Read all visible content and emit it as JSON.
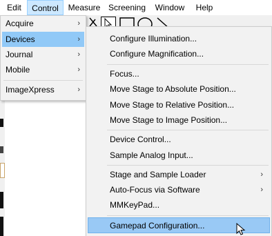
{
  "menubar": {
    "items": [
      {
        "label": "Edit"
      },
      {
        "label": "Control"
      },
      {
        "label": "Measure"
      },
      {
        "label": "Screening"
      },
      {
        "label": "Window"
      },
      {
        "label": "Help"
      }
    ]
  },
  "control_menu": {
    "items": [
      {
        "label": "Acquire",
        "submenu": true
      },
      {
        "label": "Devices",
        "submenu": true
      },
      {
        "label": "Journal",
        "submenu": true
      },
      {
        "label": "Mobile",
        "submenu": true
      },
      {
        "label": "ImageXpress",
        "submenu": true
      }
    ]
  },
  "devices_menu": {
    "items": [
      {
        "label": "Configure Illumination..."
      },
      {
        "label": "Configure Magnification..."
      },
      {
        "label": "Focus..."
      },
      {
        "label": "Move Stage to Absolute Position..."
      },
      {
        "label": "Move Stage to Relative Position..."
      },
      {
        "label": "Move Stage to Image Position..."
      },
      {
        "label": "Device Control..."
      },
      {
        "label": "Sample Analog Input..."
      },
      {
        "label": "Stage and Sample Loader",
        "submenu": true
      },
      {
        "label": "Auto-Focus via Software",
        "submenu": true
      },
      {
        "label": "MMKeyPad..."
      },
      {
        "label": "Gamepad Configuration..."
      }
    ]
  },
  "colors": {
    "menubar_active": "#cce8ff",
    "highlight": "#91c9f7",
    "menu_bg": "#f2f2f2"
  },
  "icons": [
    "submenu-arrow-icon",
    "pointer-tool-icon",
    "rectangle-tool-icon",
    "ellipse-tool-icon",
    "line-tool-icon",
    "mouse-cursor-icon"
  ]
}
